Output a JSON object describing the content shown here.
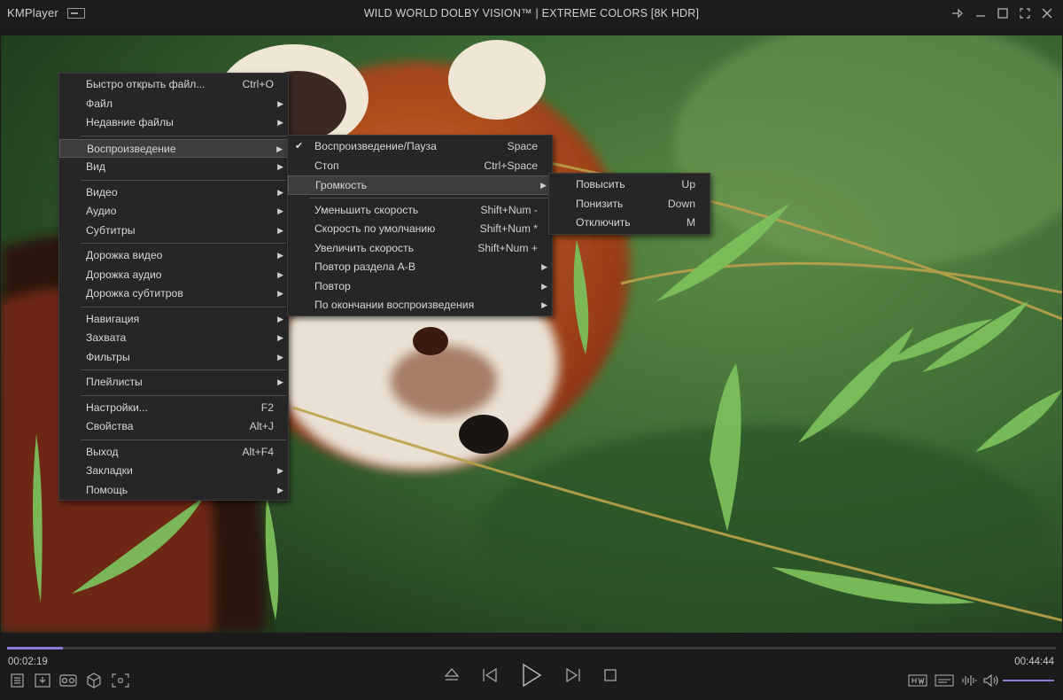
{
  "app": {
    "name": "KMPlayer"
  },
  "window": {
    "title": "WILD WORLD DOLBY VISION™ | EXTREME COLORS [8K HDR]"
  },
  "main_menu": [
    {
      "label": "Быстро открыть файл...",
      "shortcut": "Ctrl+O",
      "submenu": false
    },
    {
      "label": "Файл",
      "shortcut": "",
      "submenu": true
    },
    {
      "label": "Недавние файлы",
      "shortcut": "",
      "submenu": true
    },
    {
      "separator": true
    },
    {
      "label": "Воспроизведение",
      "shortcut": "",
      "submenu": true,
      "highlighted": true
    },
    {
      "label": "Вид",
      "shortcut": "",
      "submenu": true
    },
    {
      "separator": true
    },
    {
      "label": "Видео",
      "shortcut": "",
      "submenu": true
    },
    {
      "label": "Аудио",
      "shortcut": "",
      "submenu": true
    },
    {
      "label": "Субтитры",
      "shortcut": "",
      "submenu": true
    },
    {
      "separator": true
    },
    {
      "label": "Дорожка видео",
      "shortcut": "",
      "submenu": true
    },
    {
      "label": "Дорожка аудио",
      "shortcut": "",
      "submenu": true
    },
    {
      "label": "Дорожка субтитров",
      "shortcut": "",
      "submenu": true
    },
    {
      "separator": true
    },
    {
      "label": "Навигация",
      "shortcut": "",
      "submenu": true
    },
    {
      "label": "Захвата",
      "shortcut": "",
      "submenu": true
    },
    {
      "label": "Фильтры",
      "shortcut": "",
      "submenu": true
    },
    {
      "separator": true
    },
    {
      "label": "Плейлисты",
      "shortcut": "",
      "submenu": true
    },
    {
      "separator": true
    },
    {
      "label": "Настройки...",
      "shortcut": "F2",
      "submenu": false
    },
    {
      "label": "Свойства",
      "shortcut": "Alt+J",
      "submenu": false
    },
    {
      "separator": true
    },
    {
      "label": "Выход",
      "shortcut": "Alt+F4",
      "submenu": false
    },
    {
      "label": "Закладки",
      "shortcut": "",
      "submenu": true
    },
    {
      "label": "Помощь",
      "shortcut": "",
      "submenu": true
    }
  ],
  "playback_menu": [
    {
      "label": "Воспроизведение/Пауза",
      "shortcut": "Space",
      "submenu": false,
      "checked": true
    },
    {
      "label": "Стоп",
      "shortcut": "Ctrl+Space",
      "submenu": false
    },
    {
      "label": "Громкость",
      "shortcut": "",
      "submenu": true,
      "highlighted": true
    },
    {
      "separator": true
    },
    {
      "label": "Уменьшить скорость",
      "shortcut": "Shift+Num -",
      "submenu": false
    },
    {
      "label": "Скорость по умолчанию",
      "shortcut": "Shift+Num *",
      "submenu": false
    },
    {
      "label": "Увеличить скорость",
      "shortcut": "Shift+Num +",
      "submenu": false
    },
    {
      "label": "Повтор раздела A-B",
      "shortcut": "",
      "submenu": true
    },
    {
      "label": "Повтор",
      "shortcut": "",
      "submenu": true
    },
    {
      "label": "По окончании воспроизведения",
      "shortcut": "",
      "submenu": true
    }
  ],
  "volume_menu": [
    {
      "label": "Повысить",
      "shortcut": "Up",
      "submenu": false
    },
    {
      "label": "Понизить",
      "shortcut": "Down",
      "submenu": false
    },
    {
      "label": "Отключить",
      "shortcut": "M",
      "submenu": false
    }
  ],
  "player": {
    "current_time": "00:02:19",
    "total_time": "00:44:44",
    "progress": 0.053,
    "volume_level": 1.0
  },
  "glyphs": {
    "checkmark": "✔",
    "submenu_arrow": "▶"
  },
  "icons": {
    "titlebar": [
      "pin-icon",
      "minimize-icon",
      "maximize-icon",
      "fullscreen-icon",
      "close-icon"
    ],
    "left_controls": [
      "playlist-icon",
      "download-icon",
      "vr-icon",
      "3d-cube-icon",
      "capture-icon"
    ],
    "center_controls": [
      "eject-icon",
      "previous-icon",
      "play-icon",
      "next-icon",
      "stop-icon"
    ],
    "right_controls": [
      "hw-decoder-icon",
      "subtitle-icon",
      "equalizer-icon",
      "volume-icon"
    ]
  },
  "colors": {
    "accent": "#8b7bd8",
    "menu_bg": "#262626",
    "menu_highlight": "#3d3d3d"
  }
}
